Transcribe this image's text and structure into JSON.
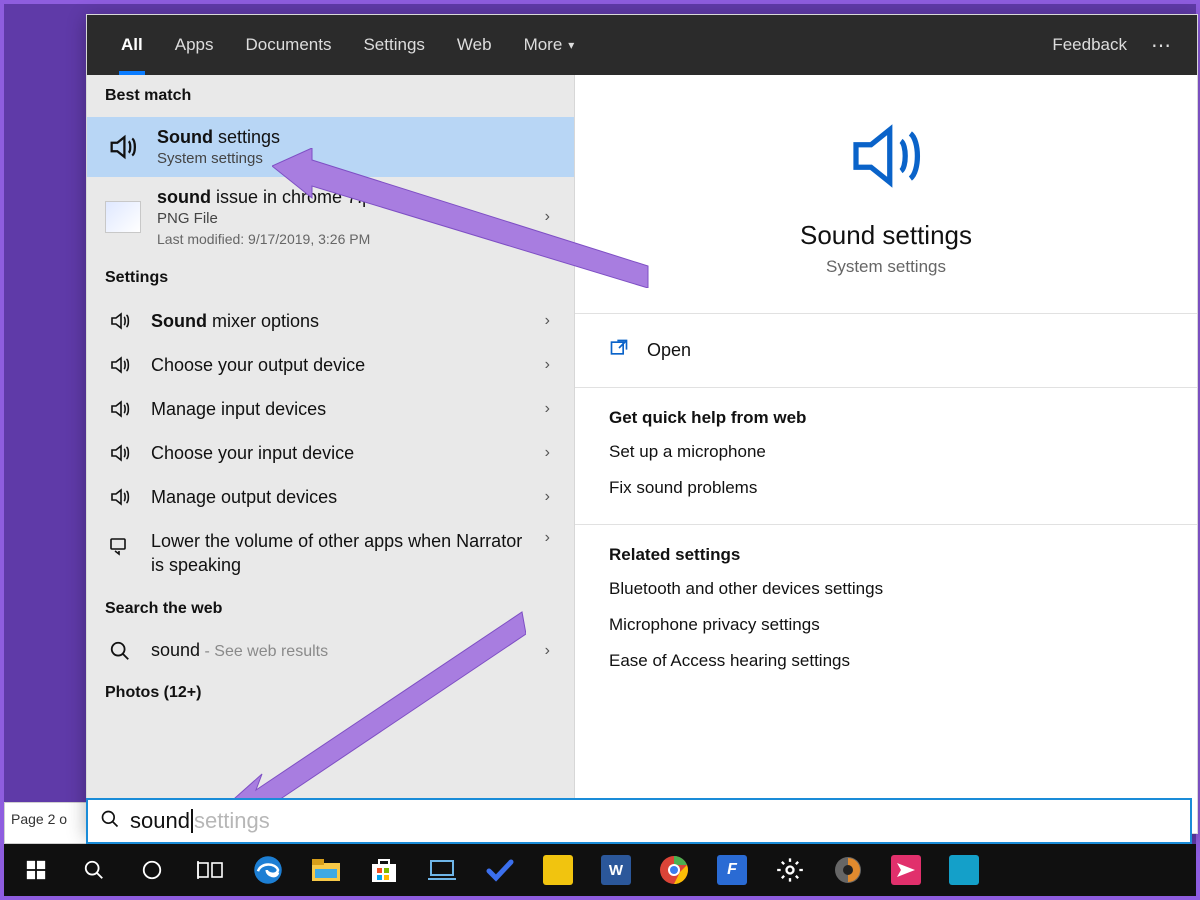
{
  "tabs": {
    "all": "All",
    "apps": "Apps",
    "documents": "Documents",
    "settings": "Settings",
    "web": "Web",
    "more": "More",
    "feedback": "Feedback"
  },
  "left": {
    "best_match_label": "Best match",
    "best_match": {
      "title_bold": "Sound",
      "title_rest": " settings",
      "subtitle": "System settings"
    },
    "file": {
      "title_bold": "sound",
      "title_rest": " issue in chrome 7.png",
      "subtitle": "PNG File",
      "meta": "Last modified: 9/17/2019, 3:26 PM"
    },
    "settings_label": "Settings",
    "settings_items": [
      {
        "bold": "Sound",
        "rest": " mixer options"
      },
      {
        "bold": "",
        "rest": "Choose your output device"
      },
      {
        "bold": "",
        "rest": "Manage input devices"
      },
      {
        "bold": "",
        "rest": "Choose your input device"
      },
      {
        "bold": "",
        "rest": "Manage output devices"
      }
    ],
    "narrator": "Lower the volume of other apps when Narrator is speaking",
    "search_web_label": "Search the web",
    "web": {
      "term": "sound",
      "suffix": " - See web results"
    },
    "photos_label": "Photos (12+)"
  },
  "right": {
    "title": "Sound settings",
    "subtitle": "System settings",
    "open": "Open",
    "quick_help_label": "Get quick help from web",
    "quick_help": [
      "Set up a microphone",
      "Fix sound problems"
    ],
    "related_label": "Related settings",
    "related": [
      "Bluetooth and other devices settings",
      "Microphone privacy settings",
      "Ease of Access hearing settings"
    ]
  },
  "search": {
    "typed": "sound",
    "ghost": "settings"
  },
  "page_strip": "Page 2 o"
}
